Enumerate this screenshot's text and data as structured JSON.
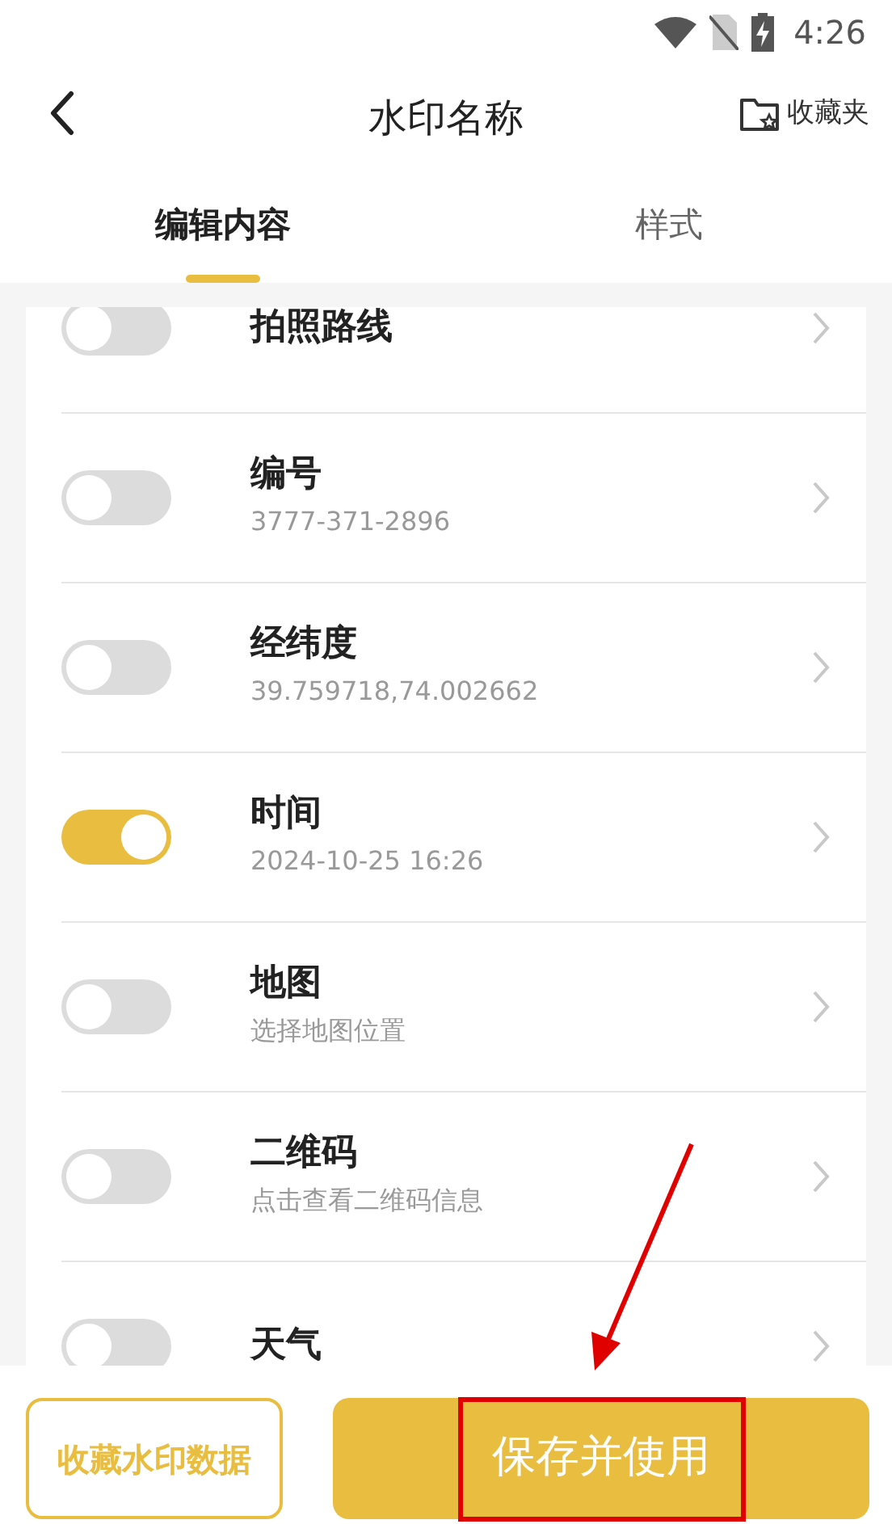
{
  "status_bar": {
    "time": "4:26"
  },
  "header": {
    "title": "水印名称",
    "favorites": "收藏夹"
  },
  "tabs": [
    {
      "label": "编辑内容",
      "selected": true
    },
    {
      "label": "样式",
      "selected": false
    }
  ],
  "items": [
    {
      "title": "拍照路线",
      "on": false
    },
    {
      "title": "编号",
      "subtitle": "3777-371-2896",
      "on": false
    },
    {
      "title": "经纬度",
      "subtitle": "39.759718,74.002662",
      "on": false
    },
    {
      "title": "时间",
      "subtitle": "2024-10-25 16:26",
      "on": true
    },
    {
      "title": "地图",
      "subtitle": "选择地图位置",
      "on": false
    },
    {
      "title": "二维码",
      "subtitle": "点击查看二维码信息",
      "on": false
    },
    {
      "title": "天气",
      "on": false
    }
  ],
  "buttons": {
    "secondary": "收藏水印数据",
    "primary": "保存并使用"
  },
  "annotation": {
    "arrow": true,
    "frame": true
  }
}
